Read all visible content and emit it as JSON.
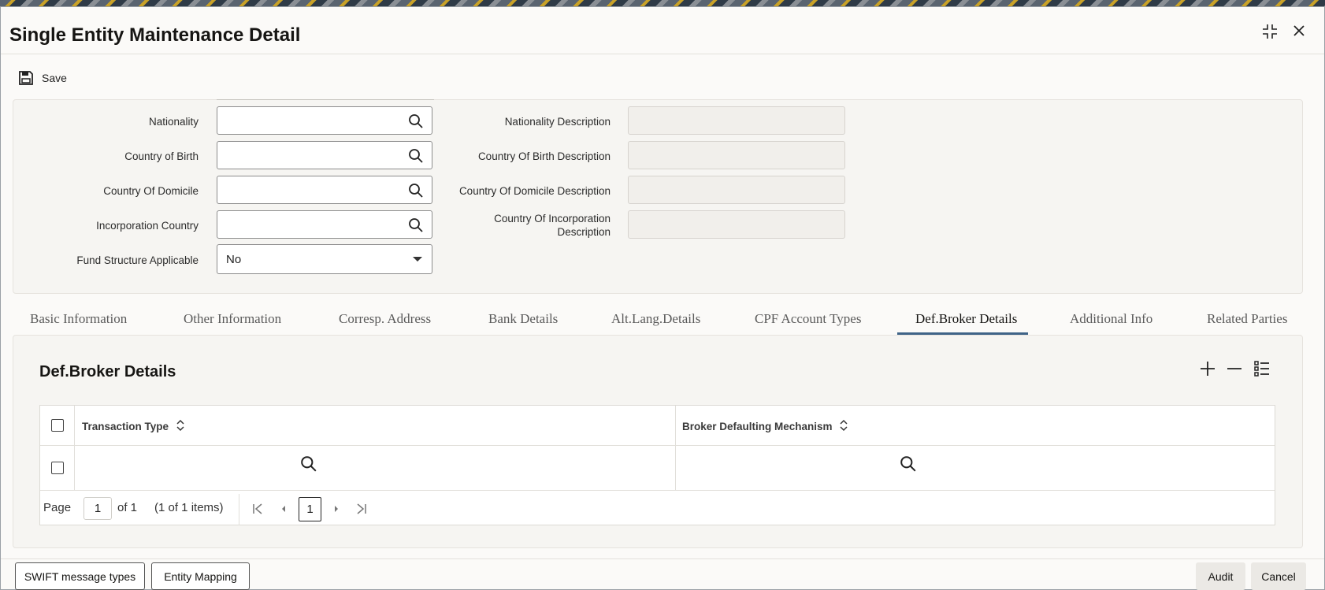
{
  "window": {
    "title": "Single Entity Maintenance Detail"
  },
  "toolbar": {
    "save_label": "Save"
  },
  "form": {
    "nationality_label": "Nationality",
    "country_of_birth_label": "Country of Birth",
    "country_of_domicile_label": "Country Of Domicile",
    "incorporation_country_label": "Incorporation Country",
    "fund_structure_label": "Fund Structure Applicable",
    "fund_structure_value": "No",
    "nationality_desc_label": "Nationality Description",
    "country_of_birth_desc_label": "Country Of Birth Description",
    "country_of_domicile_desc_label": "Country Of Domicile Description",
    "incorporation_desc_label_line1": "Country Of Incorporation",
    "incorporation_desc_label_line2": "Description"
  },
  "tabs": [
    {
      "label": "Basic Information"
    },
    {
      "label": "Other Information"
    },
    {
      "label": "Corresp. Address"
    },
    {
      "label": "Bank Details"
    },
    {
      "label": "Alt.Lang.Details"
    },
    {
      "label": "CPF Account Types"
    },
    {
      "label": "Def.Broker Details",
      "active": true
    },
    {
      "label": "Additional Info"
    },
    {
      "label": "Related Parties"
    }
  ],
  "grid": {
    "title": "Def.Broker Details",
    "columns": [
      "Transaction Type",
      "Broker Defaulting Mechanism"
    ],
    "pagination": {
      "page_label": "Page",
      "page_value": "1",
      "of_label": "of 1",
      "items_label": "(1 of 1 items)",
      "current_page": "1"
    }
  },
  "footer": {
    "swift_label": "SWIFT message types",
    "entity_mapping_label": "Entity Mapping",
    "audit_label": "Audit",
    "cancel_label": "Cancel"
  },
  "icons": {
    "save": "floppy-disk-icon",
    "search": "magnifier-icon",
    "maximize": "collapse-corners-icon",
    "close": "close-icon",
    "add": "plus-icon",
    "remove": "minus-icon",
    "columns": "list-settings-icon",
    "sort": "sort-chevrons-icon"
  },
  "colors": {
    "active_tab_underline": "#3f6387"
  }
}
